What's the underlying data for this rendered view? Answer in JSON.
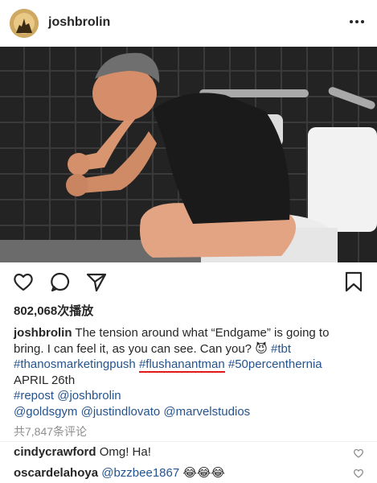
{
  "post": {
    "username": "joshbrolin",
    "likes_text": "802,068次播放",
    "caption": {
      "username": "joshbrolin",
      "line1_text": "The tension around what “Endgame” is going to",
      "line2_text": "bring. I can feel it, as you can see. Can you?",
      "emoji": "😈",
      "tag_tbt": "#tbt",
      "tag_thanos": "#thanosmarketingpush",
      "tag_flush": "#flushanantman",
      "tag_50": "#50percenthernia",
      "line4_text": "APRIL 26th",
      "tag_repost": "#repost",
      "mention_josh": "@joshbrolin",
      "mention_goldsgym": "@goldsgym",
      "mention_justin": "@justindlovato",
      "mention_marvel": "@marvelstudios"
    },
    "comments_count": "共7,847条评论",
    "comments": [
      {
        "user": "cindycrawford",
        "text": "Omg! Ha!"
      },
      {
        "user": "oscardelahoya",
        "text": "@bzzbee1867",
        "emoji": "😂😂😂"
      }
    ]
  },
  "colors": {
    "hashtag": "#24548f",
    "underline": "#e31919",
    "muted": "#8e8e8e"
  }
}
